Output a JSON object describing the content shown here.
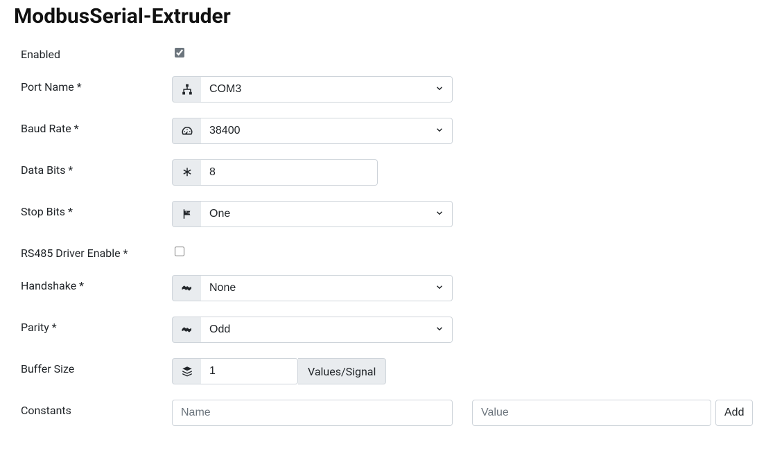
{
  "title": "ModbusSerial-Extruder",
  "labels": {
    "enabled": "Enabled",
    "portName": "Port Name *",
    "baudRate": "Baud Rate *",
    "dataBits": "Data Bits *",
    "stopBits": "Stop Bits *",
    "rs485": "RS485 Driver Enable *",
    "handshake": "Handshake *",
    "parity": "Parity *",
    "bufferSize": "Buffer Size",
    "constants": "Constants"
  },
  "values": {
    "enabled": true,
    "portName": "COM3",
    "baudRate": "38400",
    "dataBits": "8",
    "stopBits": "One",
    "rs485": false,
    "handshake": "None",
    "parity": "Odd",
    "bufferSize": "1",
    "bufferSuffix": "Values/Signal"
  },
  "constants": {
    "namePlaceholder": "Name",
    "valuePlaceholder": "Value",
    "addLabel": "Add"
  }
}
